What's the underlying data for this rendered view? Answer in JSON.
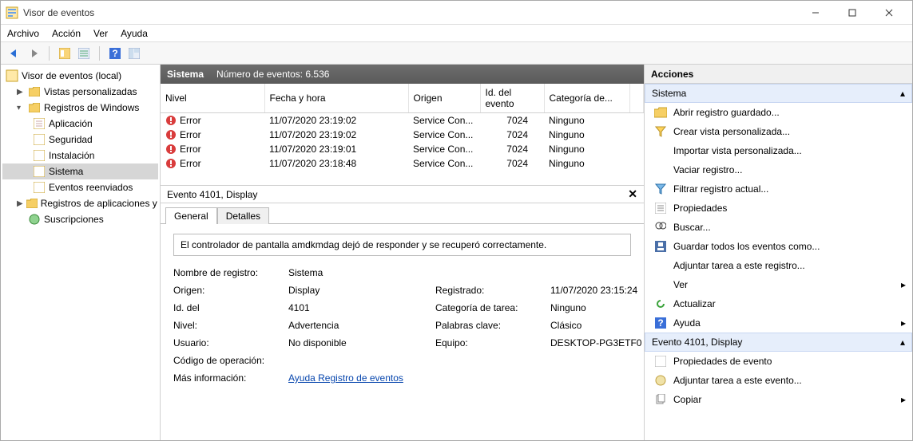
{
  "window": {
    "title": "Visor de eventos"
  },
  "menu": {
    "file": "Archivo",
    "action": "Acción",
    "view": "Ver",
    "help": "Ayuda"
  },
  "tree": {
    "root": "Visor de eventos (local)",
    "custom": "Vistas personalizadas",
    "winlogs": "Registros de Windows",
    "app": "Aplicación",
    "sec": "Seguridad",
    "inst": "Instalación",
    "sys": "Sistema",
    "fwd": "Eventos reenviados",
    "appservices": "Registros de aplicaciones y s",
    "subs": "Suscripciones"
  },
  "center_header": {
    "title": "Sistema",
    "count_label": "Número de eventos: 6.536"
  },
  "columns": {
    "level": "Nivel",
    "date": "Fecha y hora",
    "source": "Origen",
    "id": "Id. del evento",
    "cat": "Categoría de..."
  },
  "rows": [
    {
      "level": "Error",
      "date": "11/07/2020 23:19:02",
      "source": "Service Con...",
      "id": "7024",
      "cat": "Ninguno"
    },
    {
      "level": "Error",
      "date": "11/07/2020 23:19:02",
      "source": "Service Con...",
      "id": "7024",
      "cat": "Ninguno"
    },
    {
      "level": "Error",
      "date": "11/07/2020 23:19:01",
      "source": "Service Con...",
      "id": "7024",
      "cat": "Ninguno"
    },
    {
      "level": "Error",
      "date": "11/07/2020 23:18:48",
      "source": "Service Con...",
      "id": "7024",
      "cat": "Ninguno"
    }
  ],
  "detail": {
    "header": "Evento 4101, Display",
    "tab_general": "General",
    "tab_details": "Detalles",
    "message": "El controlador de pantalla amdkmdag dejó de responder y se recuperó correctamente.",
    "k_logname": "Nombre de registro:",
    "v_logname": "Sistema",
    "k_source": "Origen:",
    "v_source": "Display",
    "k_logged": "Registrado:",
    "v_logged": "11/07/2020 23:15:24",
    "k_id": "Id. del",
    "v_id": "4101",
    "k_taskcat": "Categoría de tarea:",
    "v_taskcat": "Ninguno",
    "k_level": "Nivel:",
    "v_level": "Advertencia",
    "k_keywords": "Palabras clave:",
    "v_keywords": "Clásico",
    "k_user": "Usuario:",
    "v_user": "No disponible",
    "k_computer": "Equipo:",
    "v_computer": "DESKTOP-PG3ETF0",
    "k_opcode": "Código de operación:",
    "k_more": "Más información:",
    "v_more": "Ayuda Registro de eventos"
  },
  "actions": {
    "title": "Acciones",
    "section1": "Sistema",
    "open_saved": "Abrir registro guardado...",
    "create_view": "Crear vista personalizada...",
    "import_view": "Importar vista personalizada...",
    "clear_log": "Vaciar registro...",
    "filter": "Filtrar registro actual...",
    "properties": "Propiedades",
    "find": "Buscar...",
    "save_all": "Guardar todos los eventos como...",
    "attach_task": "Adjuntar tarea a este registro...",
    "view": "Ver",
    "refresh": "Actualizar",
    "help": "Ayuda",
    "section2": "Evento 4101, Display",
    "event_props": "Propiedades de evento",
    "attach_event": "Adjuntar tarea a este evento...",
    "copy": "Copiar"
  }
}
